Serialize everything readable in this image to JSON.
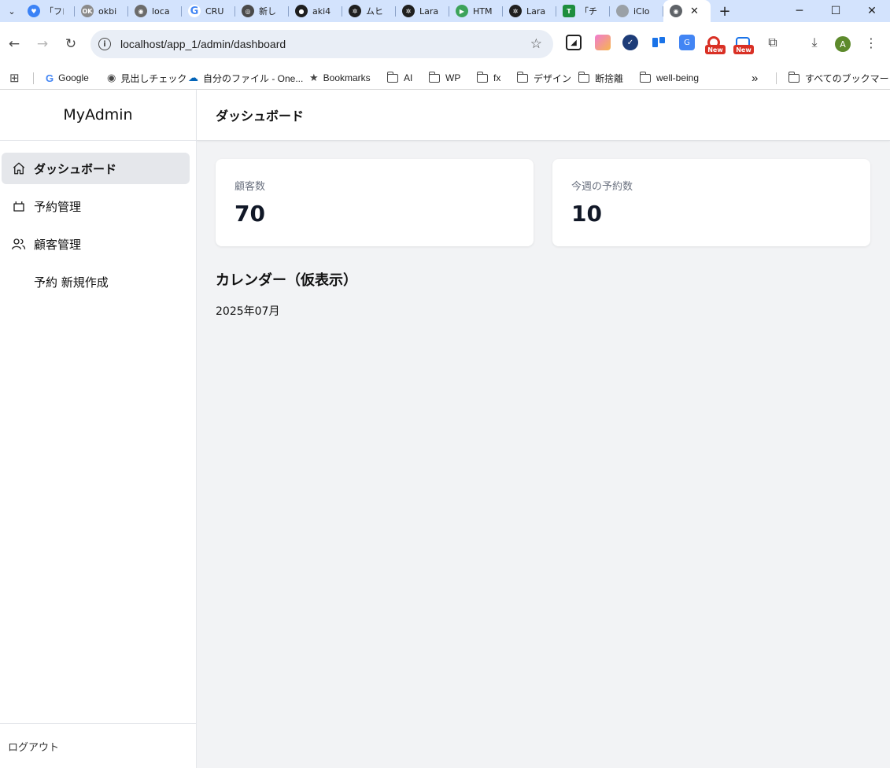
{
  "browser": {
    "tabs": [
      {
        "title": "「フロ",
        "color": "#3b82f6",
        "glyph": "♥"
      },
      {
        "title": "okbi",
        "color": "#8a8a8a",
        "glyph": "OKB"
      },
      {
        "title": "loca",
        "color": "#6b6b6b",
        "glyph": "◉"
      },
      {
        "title": "CRU",
        "color": "#ffffff",
        "glyph": "G"
      },
      {
        "title": "新し",
        "color": "#4a4a4a",
        "glyph": "◎"
      },
      {
        "title": "aki4",
        "color": "#1f1f1f",
        "glyph": "●"
      },
      {
        "title": "ムヒ",
        "color": "#1f1f1f",
        "glyph": "✲"
      },
      {
        "title": "Lara",
        "color": "#1f1f1f",
        "glyph": "✲"
      },
      {
        "title": "HTM",
        "color": "#3da35a",
        "glyph": "▶"
      },
      {
        "title": "Lara",
        "color": "#1f1f1f",
        "glyph": "✲"
      },
      {
        "title": "「チ",
        "color": "#1e8e3e",
        "glyph": "T"
      },
      {
        "title": "iClo",
        "color": "#9aa0a6",
        "glyph": ""
      }
    ],
    "active_tab_close": "✕",
    "new_tab": "+",
    "url": "localhost/app_1/admin/dashboard",
    "new_badge": "New",
    "avatar_letter": "A",
    "bookmarks": [
      {
        "label": "Google",
        "icon": "G"
      },
      {
        "label": "見出しチェック",
        "icon": "◉"
      },
      {
        "label": "自分のファイル - One...",
        "icon": "☁"
      },
      {
        "label": "Bookmarks",
        "icon": "★"
      },
      {
        "label": "AI",
        "icon": "folder"
      },
      {
        "label": "WP",
        "icon": "folder"
      },
      {
        "label": "fx",
        "icon": "folder"
      },
      {
        "label": "デザイン",
        "icon": "folder"
      },
      {
        "label": "断捨離",
        "icon": "folder"
      },
      {
        "label": "well-being",
        "icon": "folder"
      }
    ],
    "bookmarks_overflow": "»",
    "all_bookmarks": "すべてのブックマーク"
  },
  "sidebar": {
    "brand": "MyAdmin",
    "items": [
      {
        "label": "ダッシュボード",
        "icon": "home-icon"
      },
      {
        "label": "予約管理",
        "icon": "basket-icon"
      },
      {
        "label": "顧客管理",
        "icon": "users-icon"
      },
      {
        "label": "予約 新規作成",
        "icon": ""
      }
    ],
    "logout": "ログアウト"
  },
  "main": {
    "header": "ダッシュボード",
    "cards": [
      {
        "label": "顧客数",
        "value": "70"
      },
      {
        "label": "今週の予約数",
        "value": "10"
      }
    ],
    "calendar_title": "カレンダー（仮表示）",
    "calendar_month": "2025年07月"
  },
  "colors": {
    "tabstrip": "#d3e3fd",
    "sidebar_active": "#e5e7eb",
    "main_bg": "#f2f3f5"
  }
}
